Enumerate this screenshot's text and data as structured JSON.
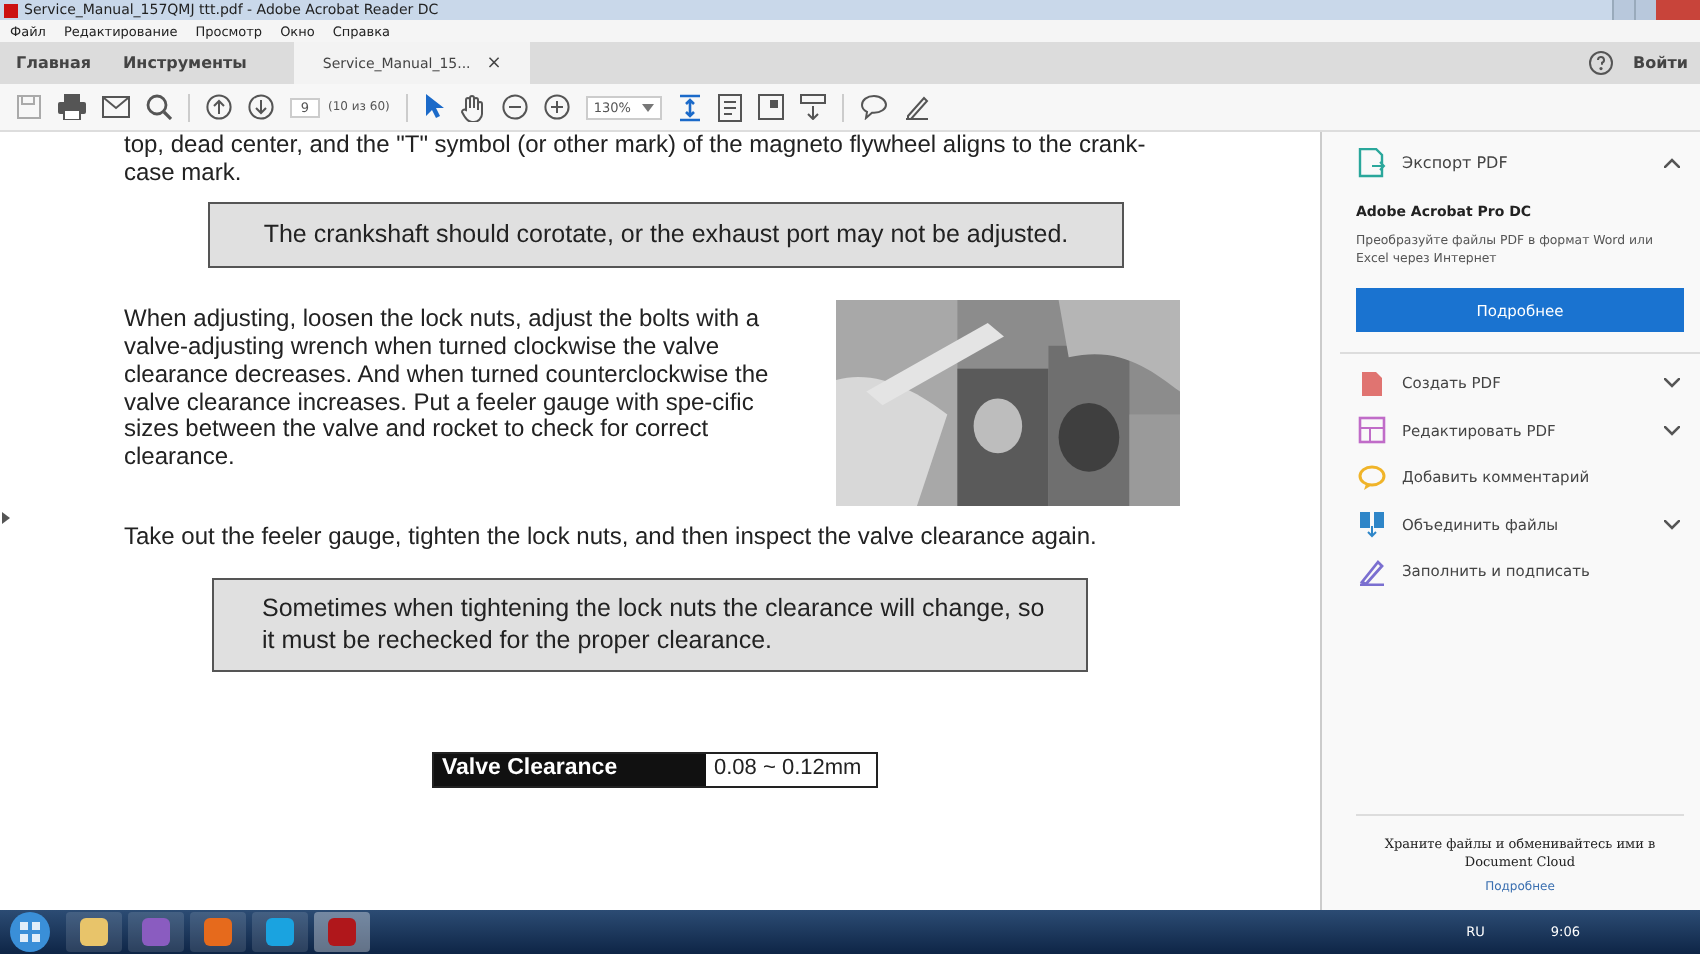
{
  "window": {
    "title": "Service_Manual_157QMJ ttt.pdf - Adobe Acrobat Reader DC"
  },
  "menu": [
    "Файл",
    "Редактирование",
    "Просмотр",
    "Окно",
    "Справка"
  ],
  "tabs": [
    {
      "label": "Главная",
      "selected": false
    },
    {
      "label": "Инструменты",
      "selected": false
    },
    {
      "label": "Service_Manual_15...",
      "selected": true,
      "close_mark": "×"
    }
  ],
  "signin": "Войти",
  "toolbar": {
    "page": "9",
    "page_count": "(10 из 60)",
    "zoom": "130%"
  },
  "document": {
    "intro": "top, dead center, and the \"T\" symbol (or other mark) of the magneto flywheel aligns to the crank-case mark.",
    "note_1": "The crankshaft should corotate, or the exhaust port may not be adjusted.",
    "paragraph_1": "When adjusting, loosen the lock nuts, adjust the bolts with a valve-adjusting wrench when turned clockwise the valve clearance decreases. And when turned counterclockwise the valve clearance increases. Put a feeler gauge with spe-cific sizes between the valve and rocket to check for correct clearance.",
    "paragraph_2": "Take out the feeler gauge, tighten the lock nuts, and then inspect the valve clearance again.",
    "note_2": "Sometimes when tightening the lock nuts the clearance will change, so it must be rechecked for the proper clearance.",
    "spec": {
      "label": "Valve Clearance",
      "value": "0.08 ~ 0.12mm"
    }
  },
  "right_pane": {
    "export": {
      "label": "Экспорт PDF",
      "expanded": true
    },
    "promo": {
      "title": "Adobe Acrobat Pro DC",
      "text": "Преобразуйте файлы PDF в формат Word или Excel через Интернет",
      "button": "Подробнее"
    },
    "tools": [
      {
        "label": "Создать PDF",
        "expandable": true
      },
      {
        "label": "Редактировать PDF",
        "expandable": true
      },
      {
        "label": "Добавить комментарий",
        "expandable": false
      },
      {
        "label": "Объединить файлы",
        "expandable": true
      },
      {
        "label": "Заполнить и подписать",
        "expandable": false
      }
    ],
    "cloud_text": "Храните файлы и обменивайтесь ими в Document Cloud",
    "cloud_link": "Подробнее"
  },
  "taskbar": {
    "language": "RU",
    "time": "9:06"
  }
}
